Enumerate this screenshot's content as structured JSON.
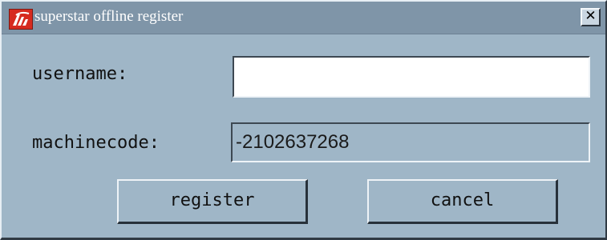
{
  "window": {
    "title": "superstar offline register",
    "close_label": "✕",
    "icon": "superstar-logo-icon"
  },
  "form": {
    "username_label": "username:",
    "username_value": "",
    "machinecode_label": "machinecode:",
    "machinecode_value": "-2102637268"
  },
  "buttons": {
    "register_label": "register",
    "cancel_label": "cancel"
  },
  "colors": {
    "titlebar": "#7f95a8",
    "body": "#9fb6c7",
    "icon_red": "#d62a1f"
  }
}
